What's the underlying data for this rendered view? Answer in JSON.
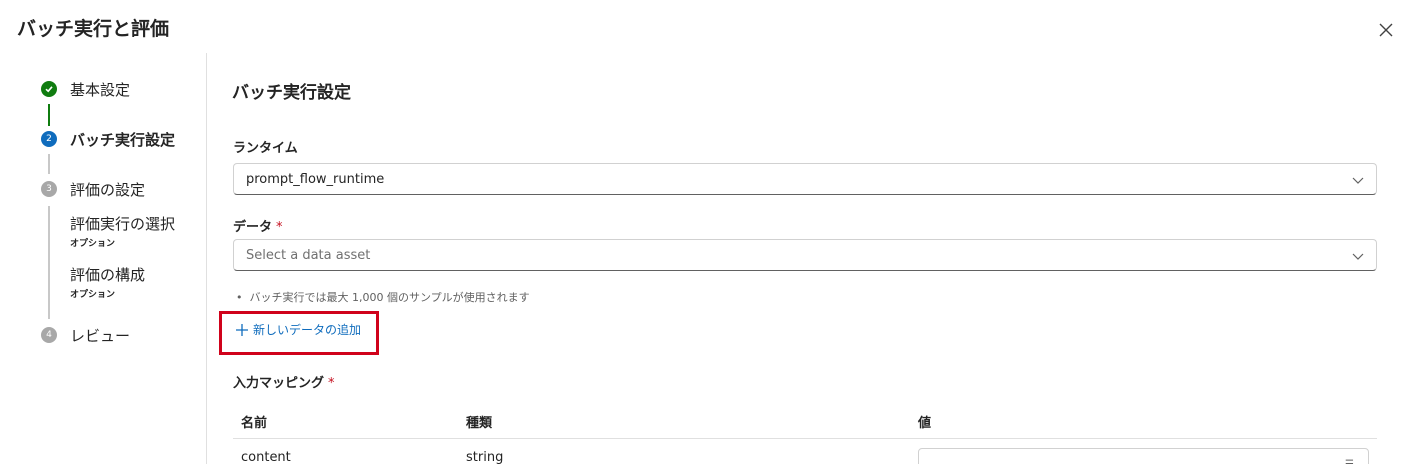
{
  "dialog": {
    "title": "バッチ実行と評価"
  },
  "stepper": {
    "steps": [
      {
        "number": "",
        "label": "基本設定",
        "state": "done"
      },
      {
        "number": "2",
        "label": "バッチ実行設定",
        "state": "active"
      },
      {
        "number": "3",
        "label": "評価の設定",
        "state": "pending"
      },
      {
        "number": "4",
        "label": "レビュー",
        "state": "pending"
      }
    ],
    "substeps": [
      {
        "label": "評価実行の選択",
        "option": "オプション"
      },
      {
        "label": "評価の構成",
        "option": "オプション"
      }
    ]
  },
  "main": {
    "section_title": "バッチ実行設定",
    "runtime": {
      "label": "ランタイム",
      "value": "prompt_flow_runtime"
    },
    "data": {
      "label": "データ",
      "required": "*",
      "placeholder": "Select a data asset"
    },
    "hint": "バッチ実行では最大 1,000 個のサンプルが使用されます",
    "add_data": {
      "label": "新しいデータの追加"
    },
    "input_mapping": {
      "label": "入力マッピング",
      "required": "*",
      "headers": [
        "名前",
        "種類",
        "値"
      ],
      "rows": [
        {
          "name": "content",
          "type": "string",
          "value": ""
        }
      ]
    }
  },
  "colors": {
    "accent": "#0f6cbd",
    "success": "#107c10",
    "highlight": "#d0021b"
  }
}
